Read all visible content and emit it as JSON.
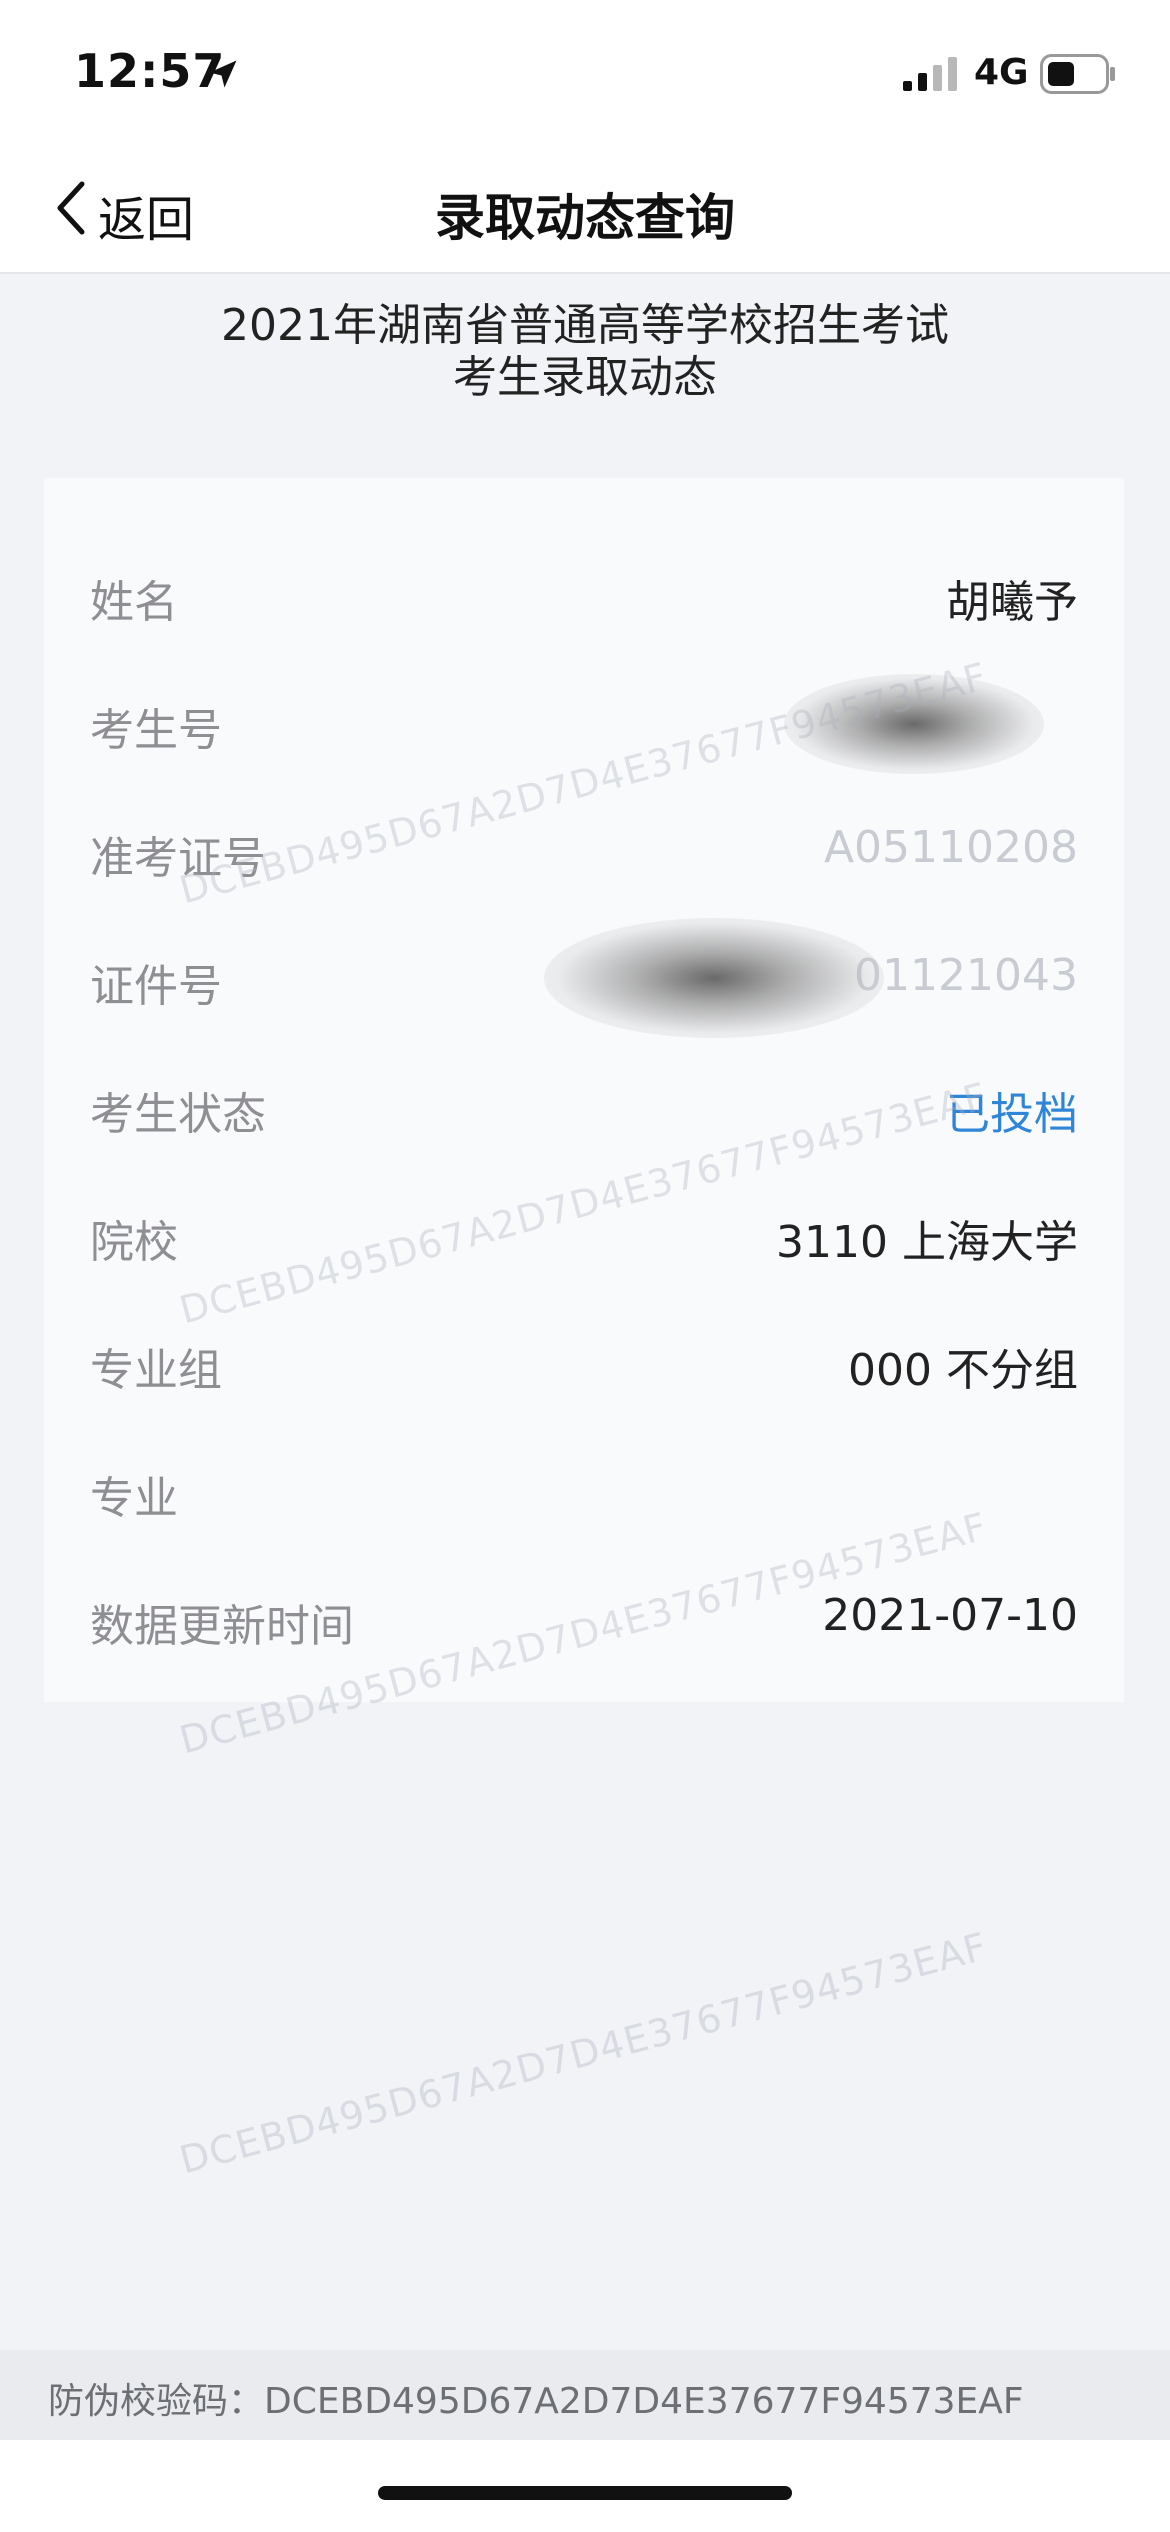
{
  "status_bar": {
    "time": "12:57",
    "network": "4G"
  },
  "nav": {
    "back_label": "返回",
    "title": "录取动态查询"
  },
  "header": {
    "line1": "2021年湖南省普通高等学校招生考试",
    "line2": "考生录取动态"
  },
  "rows": [
    {
      "label": "姓名",
      "value": "胡曦予"
    },
    {
      "label": "考生号",
      "value": ""
    },
    {
      "label": "准考证号",
      "value": "A05110208"
    },
    {
      "label": "证件号",
      "value": "01121043"
    },
    {
      "label": "考生状态",
      "value": "已投档"
    },
    {
      "label": "院校",
      "value": "3110 上海大学"
    },
    {
      "label": "专业组",
      "value": "000 不分组"
    },
    {
      "label": "专业",
      "value": ""
    },
    {
      "label": "数据更新时间",
      "value": "2021-07-10"
    }
  ],
  "watermark_text": "DCEBD495D67A2D7D4E37677F94573EAF",
  "footer": {
    "verification": "防伪校验码：DCEBD495D67A2D7D4E37677F94573EAF"
  },
  "colors": {
    "link": "#2f86d6",
    "background": "#f1f3f7"
  }
}
